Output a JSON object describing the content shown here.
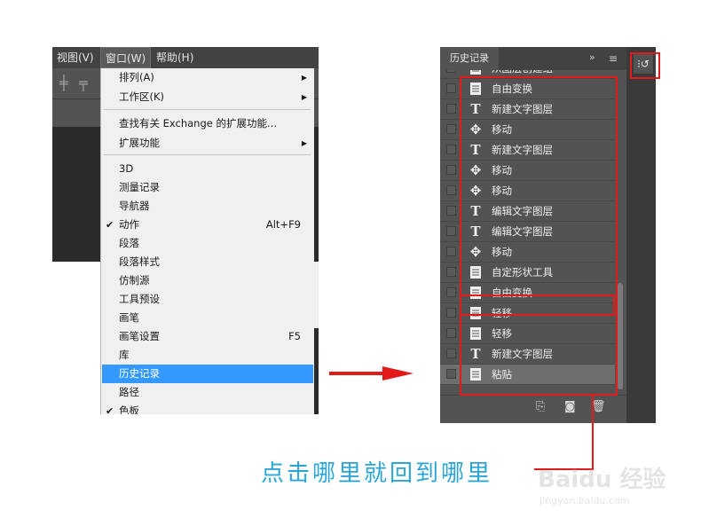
{
  "left_screenshot": {
    "menubar": [
      {
        "label": "视图(V)",
        "active": false
      },
      {
        "label": "窗口(W)",
        "active": true
      },
      {
        "label": "帮助(H)",
        "active": false
      }
    ],
    "window_menu": {
      "items": [
        {
          "label": "排列(A)",
          "submenu": true
        },
        {
          "label": "工作区(K)",
          "submenu": true
        },
        {
          "label": "查找有关 Exchange 的扩展功能..."
        },
        {
          "label": "扩展功能",
          "submenu": true
        },
        {
          "label": "3D"
        },
        {
          "label": "测量记录"
        },
        {
          "label": "导航器"
        },
        {
          "label": "动作",
          "checked": true,
          "shortcut": "Alt+F9"
        },
        {
          "label": "段落"
        },
        {
          "label": "段落样式"
        },
        {
          "label": "仿制源"
        },
        {
          "label": "工具预设"
        },
        {
          "label": "画笔"
        },
        {
          "label": "画笔设置",
          "shortcut": "F5"
        },
        {
          "label": "库"
        },
        {
          "label": "历史记录",
          "highlighted": true
        },
        {
          "label": "路径"
        },
        {
          "label": "色板",
          "checked": true
        }
      ]
    }
  },
  "history_panel": {
    "tab_label": "历史记录",
    "more_glyph": "»",
    "menu_glyph": "≡",
    "items": [
      {
        "icon": "doc",
        "label": "从图层创建组"
      },
      {
        "icon": "doc",
        "label": "自由变换"
      },
      {
        "icon": "text",
        "label": "新建文字图层"
      },
      {
        "icon": "move",
        "label": "移动"
      },
      {
        "icon": "text",
        "label": "新建文字图层"
      },
      {
        "icon": "move",
        "label": "移动"
      },
      {
        "icon": "move",
        "label": "移动"
      },
      {
        "icon": "text",
        "label": "编辑文字图层"
      },
      {
        "icon": "text",
        "label": "编辑文字图层"
      },
      {
        "icon": "move",
        "label": "移动"
      },
      {
        "icon": "doc",
        "label": "自定形状工具"
      },
      {
        "icon": "doc",
        "label": "自由变换"
      },
      {
        "icon": "doc",
        "label": "轻移"
      },
      {
        "icon": "doc",
        "label": "轻移"
      },
      {
        "icon": "text",
        "label": "新建文字图层"
      },
      {
        "icon": "doc",
        "label": "粘贴",
        "selected": true
      }
    ]
  },
  "caption": "点击哪里就回到哪里",
  "watermark": {
    "brand": "Baidu 经验",
    "url": "jingyan.baidu.com"
  },
  "colors": {
    "highlight_red": "#e21a1a",
    "caption_blue": "#2aa5d8",
    "menu_highlight": "#3399ff"
  }
}
